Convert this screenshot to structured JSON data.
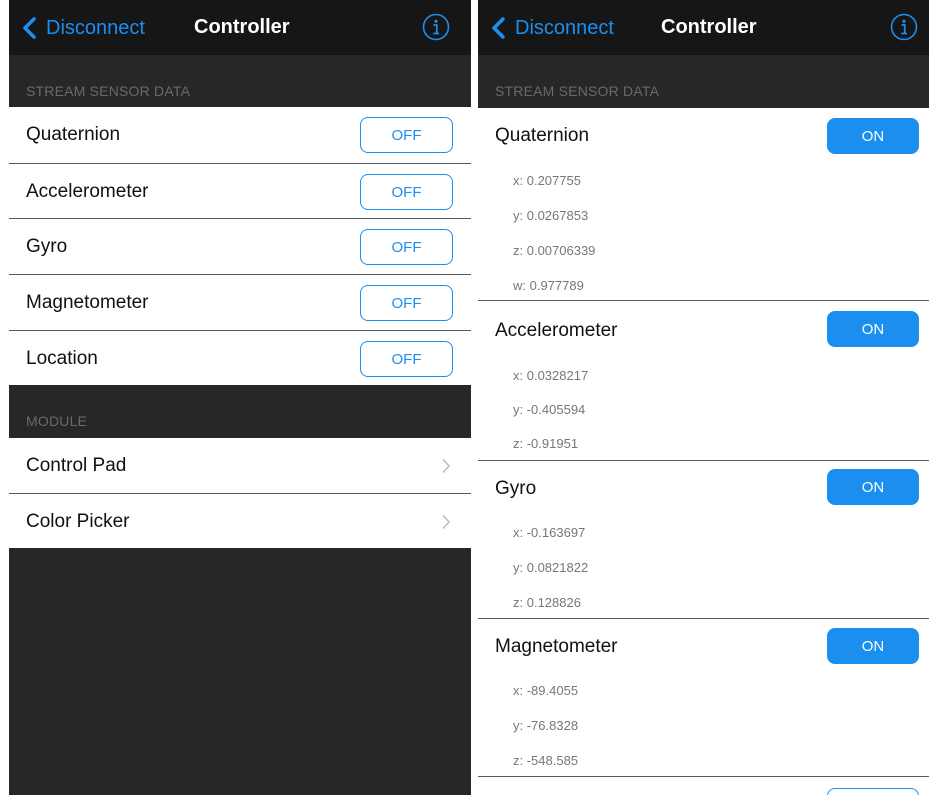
{
  "nav": {
    "back_label": "Disconnect",
    "title": "Controller"
  },
  "left": {
    "stream_header": "STREAM SENSOR DATA",
    "sensors": [
      {
        "label": "Quaternion",
        "state": "OFF"
      },
      {
        "label": "Accelerometer",
        "state": "OFF"
      },
      {
        "label": "Gyro",
        "state": "OFF"
      },
      {
        "label": "Magnetometer",
        "state": "OFF"
      },
      {
        "label": "Location",
        "state": "OFF"
      }
    ],
    "module_header": "MODULE",
    "modules": [
      {
        "label": "Control Pad"
      },
      {
        "label": "Color Picker"
      }
    ]
  },
  "right": {
    "stream_header": "STREAM SENSOR DATA",
    "sensors": [
      {
        "label": "Quaternion",
        "state": "ON",
        "values": [
          "x: 0.207755",
          "y: 0.0267853",
          "z: 0.00706339",
          "w: 0.977789"
        ]
      },
      {
        "label": "Accelerometer",
        "state": "ON",
        "values": [
          "x: 0.0328217",
          "y: -0.405594",
          "z: -0.91951"
        ]
      },
      {
        "label": "Gyro",
        "state": "ON",
        "values": [
          "x: -0.163697",
          "y: 0.0821822",
          "z: 0.128826"
        ]
      },
      {
        "label": "Magnetometer",
        "state": "ON",
        "values": [
          "x: -89.4055",
          "y: -76.8328",
          "z: -548.585"
        ]
      }
    ]
  },
  "colors": {
    "accent": "#1a8ff0",
    "nav_background": "#161616",
    "background": "#272727",
    "section_header_text": "#6a6a6a"
  },
  "icons": {
    "back": "chevron-left-icon",
    "info": "info-icon",
    "disclosure": "chevron-right-icon"
  }
}
